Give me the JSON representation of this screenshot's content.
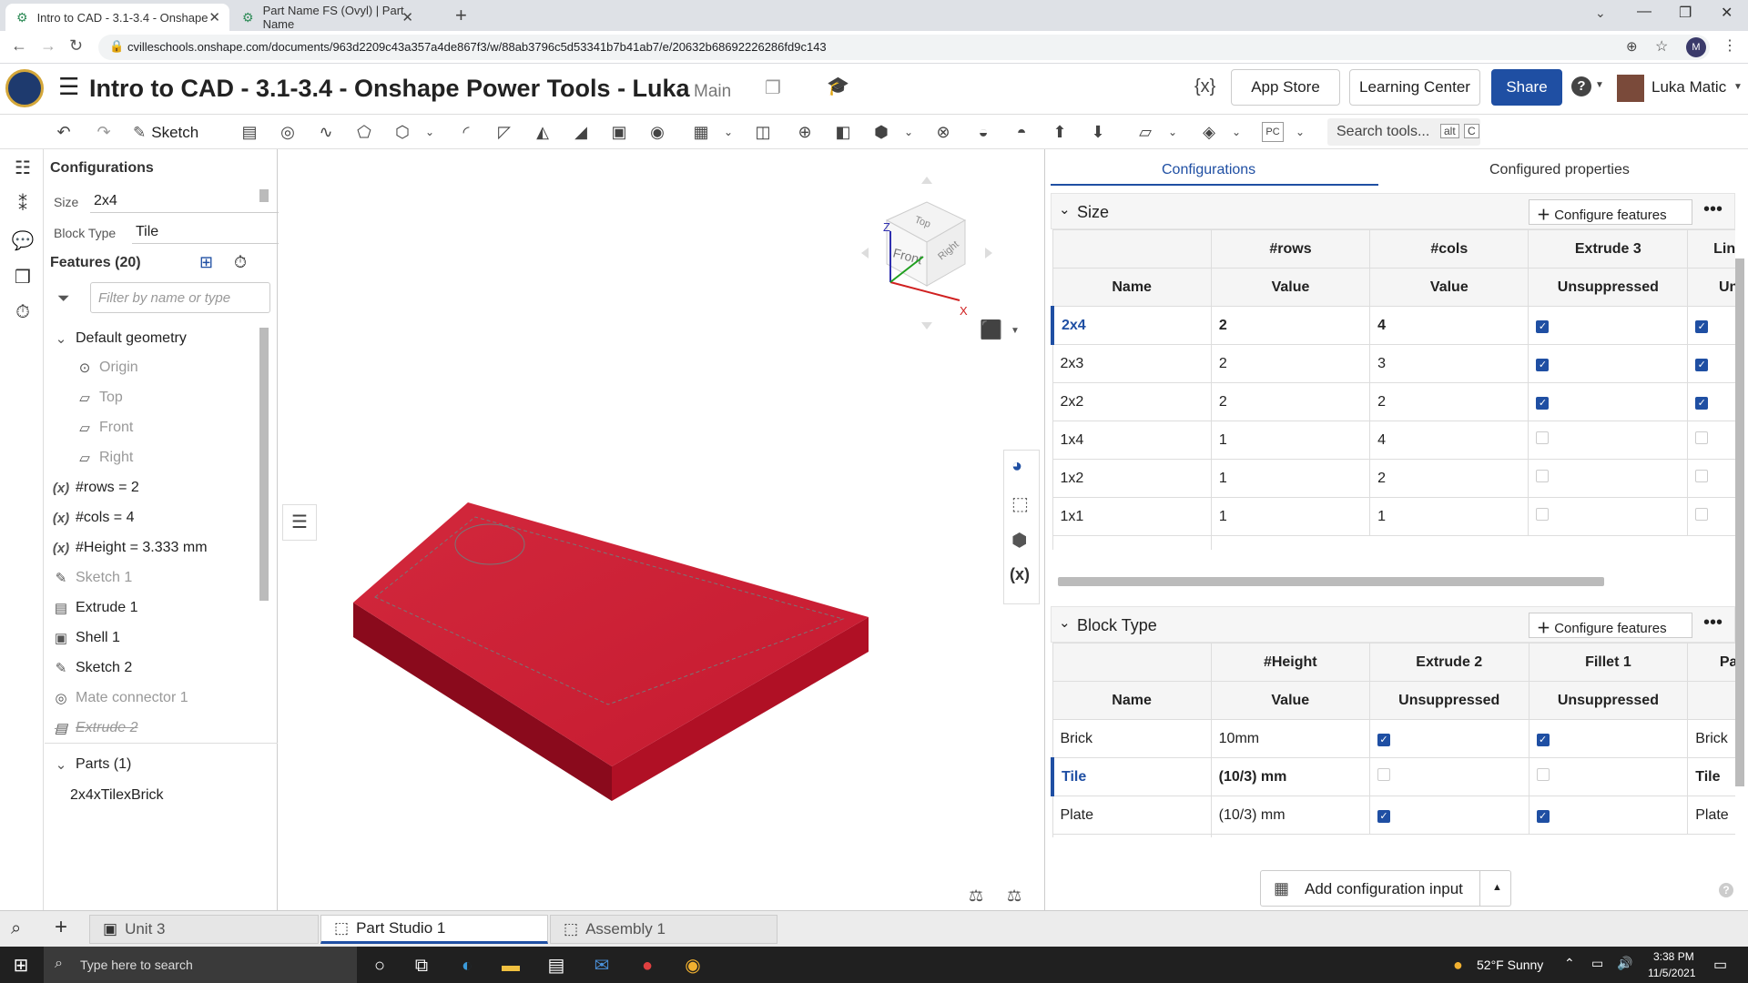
{
  "browser": {
    "tabs": [
      {
        "title": "Intro to CAD - 3.1-3.4 - Onshape"
      },
      {
        "title": "Part Name FS (Ovyl) | Part Name"
      }
    ],
    "url": "cvilleschools.onshape.com/documents/963d2209c43a357a4de867f3/w/88ab3796c5d53341b7b41ab7/e/20632b68692226286fd9c143"
  },
  "header": {
    "doc_title": "Intro to CAD - 3.1-3.4 - Onshape Power Tools - Luka",
    "branch": "Main",
    "app_store": "App Store",
    "learning_center": "Learning Center",
    "share": "Share",
    "user": "Luka Matic"
  },
  "toolbar": {
    "sketch": "Sketch",
    "units": "PC",
    "search_placeholder": "Search tools...",
    "kbd1": "alt",
    "kbd2": "C"
  },
  "feature_panel": {
    "config_title": "Configurations",
    "size_label": "Size",
    "size_value": "2x4",
    "block_label": "Block Type",
    "block_value": "Tile",
    "features_title": "Features (20)",
    "filter_placeholder": "Filter by name or type",
    "default_geometry": "Default geometry",
    "origin": "Origin",
    "top": "Top",
    "front": "Front",
    "right": "Right",
    "var_rows": "#rows = 2",
    "var_cols": "#cols = 4",
    "var_height": "#Height = 3.333 mm",
    "sketch1": "Sketch 1",
    "extrude1": "Extrude 1",
    "shell1": "Shell 1",
    "sketch2": "Sketch 2",
    "mate1": "Mate connector 1",
    "extrude2": "Extrude 2",
    "parts_title": "Parts (1)",
    "part1": "2x4xTilexBrick"
  },
  "viewcube": {
    "top": "Top",
    "front": "Front",
    "right": "Right",
    "z": "Z",
    "x": "X",
    "y": "Y"
  },
  "config_panel": {
    "tab_configs": "Configurations",
    "tab_props": "Configured properties",
    "size_section": "Size",
    "configure_features": "Configure features",
    "size_cols": [
      "#rows",
      "#cols",
      "Extrude 3",
      "Line"
    ],
    "name_header": "Name",
    "value_header": "Value",
    "unsuppressed": "Unsuppressed",
    "un_short": "Un",
    "size_rows": [
      {
        "name": "2x4",
        "rows": "2",
        "cols": "4",
        "e3": true,
        "l": true
      },
      {
        "name": "2x3",
        "rows": "2",
        "cols": "3",
        "e3": true,
        "l": true
      },
      {
        "name": "2x2",
        "rows": "2",
        "cols": "2",
        "e3": true,
        "l": true
      },
      {
        "name": "1x4",
        "rows": "1",
        "cols": "4",
        "e3": false,
        "l": false
      },
      {
        "name": "1x2",
        "rows": "1",
        "cols": "2",
        "e3": false,
        "l": false
      },
      {
        "name": "1x1",
        "rows": "1",
        "cols": "1",
        "e3": false,
        "l": false
      }
    ],
    "name_placeholder": "Name",
    "block_section": "Block Type",
    "block_cols": [
      "#Height",
      "Extrude 2",
      "Fillet 1",
      "Pa"
    ],
    "block_rows": [
      {
        "name": "Brick",
        "height": "10mm",
        "e2": true,
        "f1": true,
        "p": "Brick"
      },
      {
        "name": "Tile",
        "height": "(10/3) mm",
        "e2": false,
        "f1": false,
        "p": "Tile"
      },
      {
        "name": "Plate",
        "height": "(10/3) mm",
        "e2": true,
        "f1": true,
        "p": "Plate"
      }
    ],
    "add_input": "Add configuration input"
  },
  "doc_tabs": {
    "unit": "Unit 3",
    "partstudio": "Part Studio 1",
    "assembly": "Assembly 1"
  },
  "taskbar": {
    "search": "Type here to search",
    "weather": "52°F  Sunny",
    "time": "3:38 PM",
    "date": "11/5/2021"
  }
}
